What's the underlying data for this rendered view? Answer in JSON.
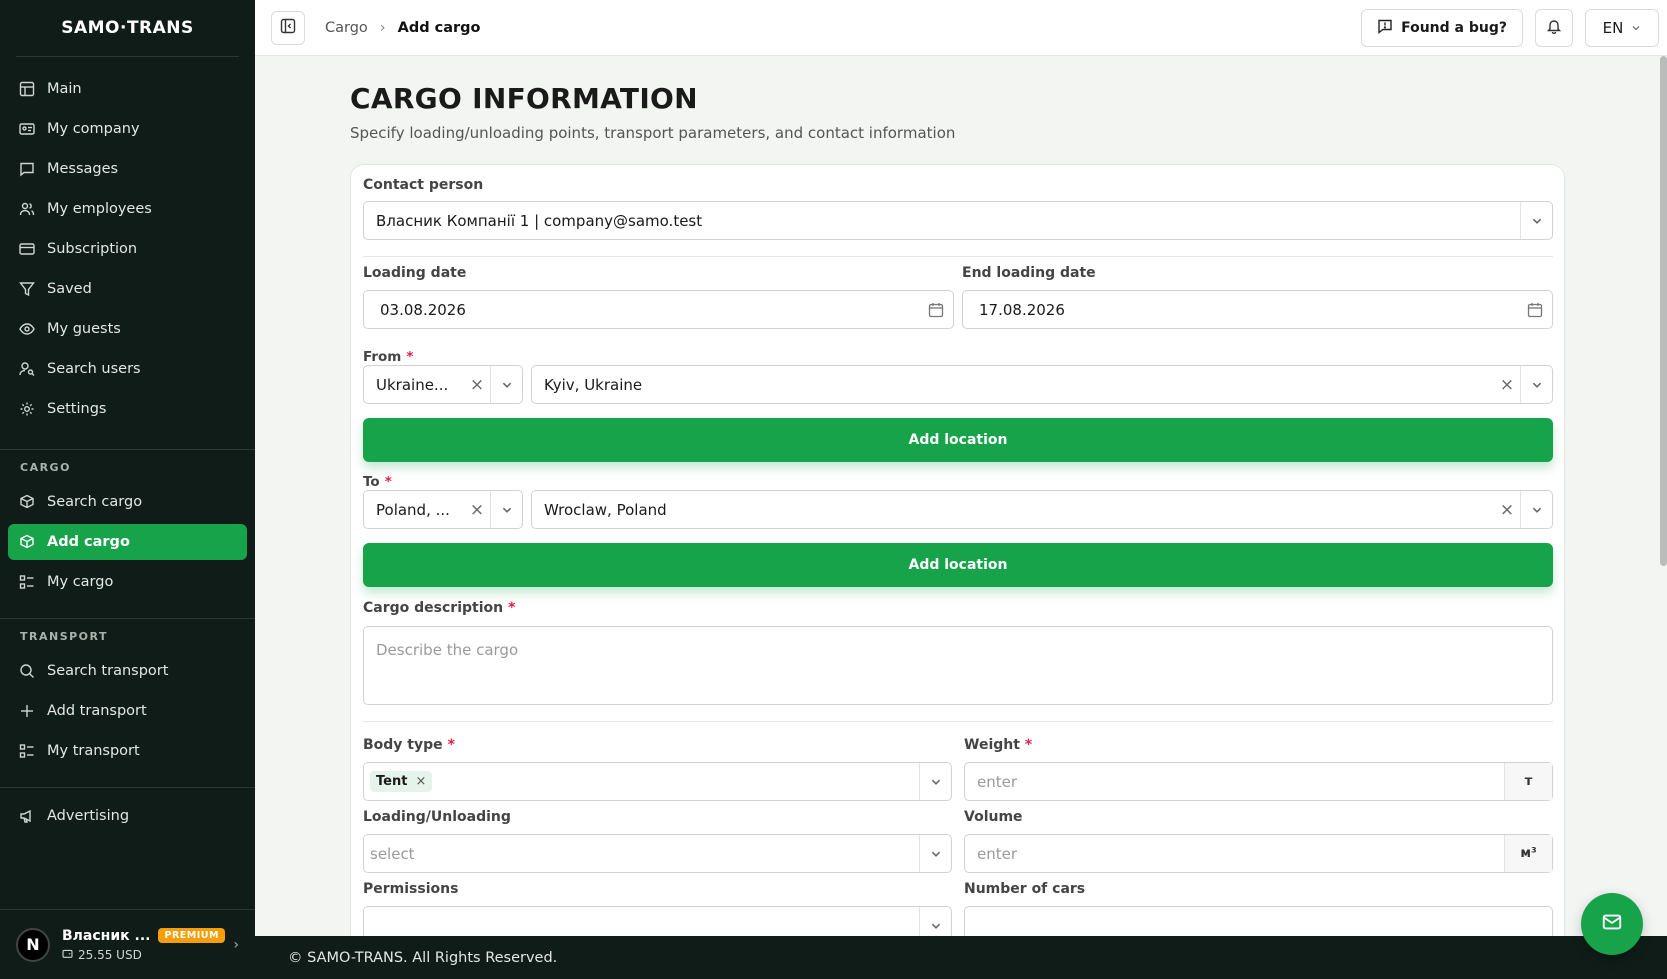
{
  "app": {
    "logo": "SAMO·TRANS"
  },
  "sidebar": {
    "main_items": [
      {
        "label": "Main",
        "icon": "table-icon"
      },
      {
        "label": "My company",
        "icon": "id-card-icon"
      },
      {
        "label": "Messages",
        "icon": "message-icon"
      },
      {
        "label": "My employees",
        "icon": "users-icon"
      },
      {
        "label": "Subscription",
        "icon": "card-icon"
      },
      {
        "label": "Saved",
        "icon": "filter-icon"
      },
      {
        "label": "My guests",
        "icon": "eye-icon"
      },
      {
        "label": "Search users",
        "icon": "user-search-icon"
      },
      {
        "label": "Settings",
        "icon": "gear-icon"
      }
    ],
    "cargo_title": "CARGO",
    "cargo_items": [
      {
        "label": "Search cargo",
        "icon": "box-search-icon"
      },
      {
        "label": "Add cargo",
        "icon": "box-plus-icon",
        "active": true
      },
      {
        "label": "My cargo",
        "icon": "list-icon"
      }
    ],
    "transport_title": "TRANSPORT",
    "transport_items": [
      {
        "label": "Search transport",
        "icon": "search-icon"
      },
      {
        "label": "Add transport",
        "icon": "plus-icon"
      },
      {
        "label": "My transport",
        "icon": "list-icon"
      }
    ],
    "advertising": {
      "label": "Advertising",
      "icon": "megaphone-icon"
    },
    "profile": {
      "initial": "N",
      "name": "Власник ...",
      "badge": "PREMIUM",
      "balance": "25.55 USD"
    }
  },
  "topbar": {
    "breadcrumb": [
      "Cargo",
      "Add cargo"
    ],
    "bug_button": "Found a bug?",
    "language": "EN"
  },
  "page": {
    "title": "CARGO INFORMATION",
    "subtitle": "Specify loading/unloading points, transport parameters, and contact information"
  },
  "form": {
    "contact_label": "Contact person",
    "contact_value": "Власник Компанії 1 | company@samo.test",
    "loading_date_label": "Loading date",
    "loading_date_value": "03.08.2026",
    "end_loading_date_label": "End loading date",
    "end_loading_date_value": "17.08.2026",
    "from_label": "From",
    "from_country": "Ukraine...",
    "from_city": "Kyiv, Ukraine",
    "add_location": "Add location",
    "to_label": "To",
    "to_country": "Poland, ...",
    "to_city": "Wroclaw, Poland",
    "description_label": "Cargo description",
    "description_placeholder": "Describe the cargo",
    "body_type_label": "Body type",
    "body_type_tag": "Tent",
    "weight_label": "Weight",
    "weight_placeholder": "enter",
    "weight_unit": "т",
    "loading_unloading_label": "Loading/Unloading",
    "loading_unloading_placeholder": "select",
    "volume_label": "Volume",
    "volume_placeholder": "enter",
    "volume_unit": "м³",
    "permissions_label": "Permissions",
    "number_of_cars_label": "Number of cars"
  },
  "footer": {
    "text": "© SAMO-TRANS. All Rights Reserved."
  },
  "colors": {
    "accent": "#16a34a",
    "sidebar_bg": "#0f1c17",
    "premium": "#f59e0b",
    "required": "#e11d48"
  }
}
